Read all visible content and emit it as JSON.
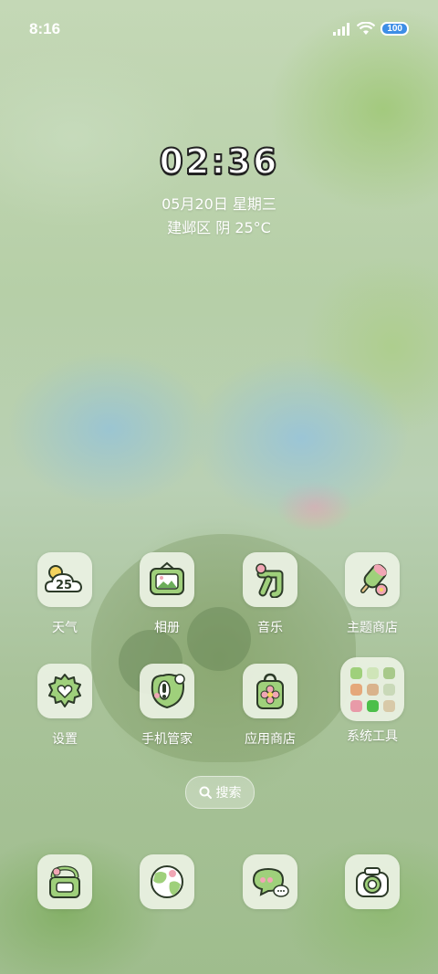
{
  "status_bar": {
    "time": "8:16",
    "battery_level": "100",
    "icons": [
      "signal-icon",
      "wifi-icon",
      "battery-icon"
    ]
  },
  "lock_widget": {
    "clock": "02:36",
    "date": "05月20日 星期三",
    "weather": "建邺区 阴 25°C"
  },
  "apps": {
    "weather": {
      "label": "天气",
      "icon": "weather-icon",
      "temp_text": "25"
    },
    "album": {
      "label": "相册",
      "icon": "photo-frame-icon"
    },
    "music": {
      "label": "音乐",
      "icon": "music-icon"
    },
    "theme_store": {
      "label": "主题商店",
      "icon": "popsicle-icon"
    },
    "settings": {
      "label": "设置",
      "icon": "gear-heart-icon"
    },
    "phone_manager": {
      "label": "手机管家",
      "icon": "frog-shield-icon"
    },
    "app_store": {
      "label": "应用商店",
      "icon": "shopping-bag-icon"
    },
    "system_tools": {
      "label": "系统工具",
      "icon": "folder-icon"
    }
  },
  "search": {
    "label": "搜索",
    "icon": "search-icon"
  },
  "dock": [
    "phone-icon",
    "browser-globe-icon",
    "message-bubble-icon",
    "camera-icon"
  ],
  "colors": {
    "icon_bg": "#ebf2e4",
    "icon_green": "#9fd07b",
    "icon_dark": "#2c3a28",
    "accent_pink": "#f1a6b5",
    "battery": "#3d8ee6"
  }
}
